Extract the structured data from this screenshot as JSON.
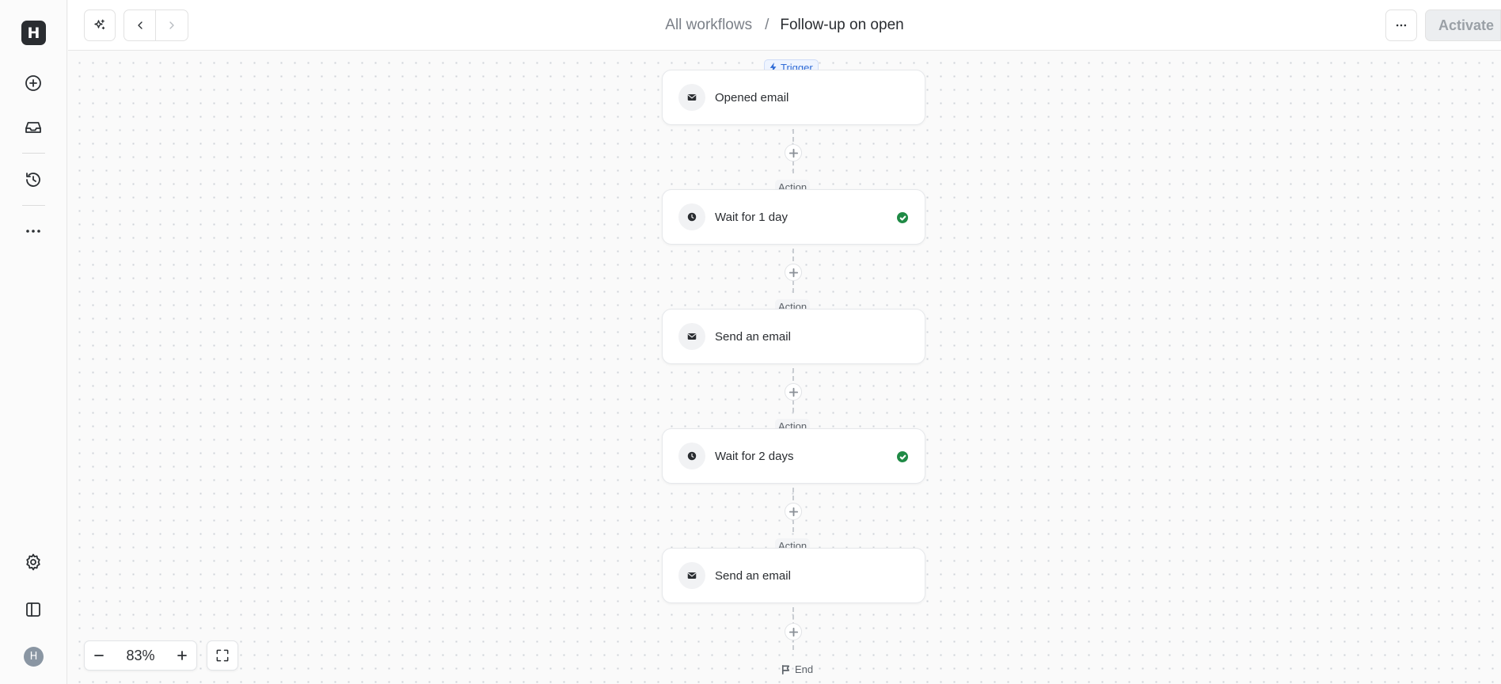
{
  "sidebar": {
    "logo_letter": "H",
    "avatar_letter": "H",
    "items": [
      {
        "name": "new",
        "icon": "plus-circle-icon"
      },
      {
        "name": "inbox",
        "icon": "inbox-icon"
      },
      {
        "name": "history",
        "icon": "history-icon"
      },
      {
        "name": "more",
        "icon": "more-horizontal-icon"
      },
      {
        "name": "settings",
        "icon": "gear-icon"
      },
      {
        "name": "toggle-sidebar",
        "icon": "sidebar-icon"
      }
    ]
  },
  "header": {
    "breadcrumb_parent": "All workflows",
    "breadcrumb_separator": "/",
    "breadcrumb_current": "Follow-up on open",
    "activate_label": "Activate"
  },
  "workflow": {
    "trigger_tag": "Trigger",
    "action_tag": "Action",
    "end_label": "End",
    "nodes": [
      {
        "title": "Opened email",
        "icon": "mail-icon",
        "complete": false
      },
      {
        "title": "Wait for 1 day",
        "icon": "clock-icon",
        "complete": true
      },
      {
        "title": "Send an email",
        "icon": "mail-icon",
        "complete": false
      },
      {
        "title": "Wait for 2 days",
        "icon": "clock-icon",
        "complete": true
      },
      {
        "title": "Send an email",
        "icon": "mail-icon",
        "complete": false
      }
    ]
  },
  "zoom": {
    "value": "83%"
  },
  "colors": {
    "accent_blue": "#2f6bd6",
    "success_green": "#1f8a45",
    "dark": "#2a2d31"
  }
}
